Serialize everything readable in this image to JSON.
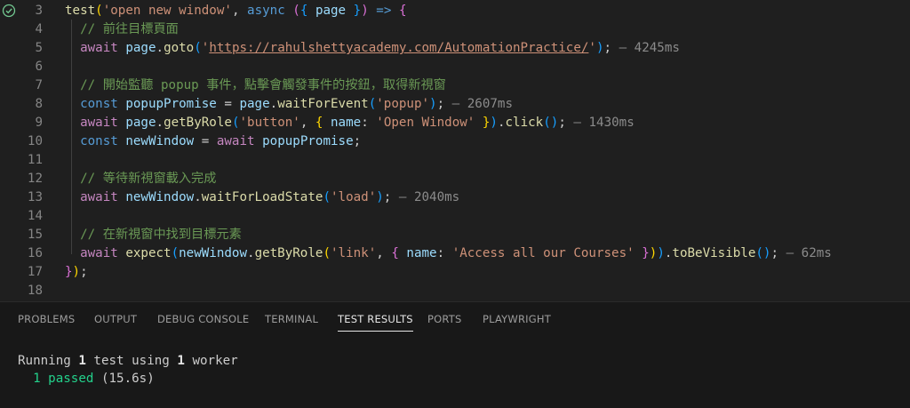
{
  "editor": {
    "lines": [
      {
        "n": "3",
        "tokens": [
          {
            "t": "test",
            "c": "fn"
          },
          {
            "t": "(",
            "c": "br1"
          },
          {
            "t": "'open new window'",
            "c": "str"
          },
          {
            "t": ", ",
            "c": "pun"
          },
          {
            "t": "async",
            "c": "kw"
          },
          {
            "t": " ",
            "c": "pun"
          },
          {
            "t": "(",
            "c": "br2"
          },
          {
            "t": "{ ",
            "c": "br3"
          },
          {
            "t": "page",
            "c": "var"
          },
          {
            "t": " }",
            "c": "br3"
          },
          {
            "t": ")",
            "c": "br2"
          },
          {
            "t": " ",
            "c": "pun"
          },
          {
            "t": "=>",
            "c": "kw"
          },
          {
            "t": " ",
            "c": "pun"
          },
          {
            "t": "{",
            "c": "br2"
          }
        ]
      },
      {
        "n": "4",
        "tokens": [
          {
            "t": "  // 前往目標頁面",
            "c": "cmt"
          }
        ]
      },
      {
        "n": "5",
        "tokens": [
          {
            "t": "  await",
            "c": "ctl"
          },
          {
            "t": " ",
            "c": "pun"
          },
          {
            "t": "page",
            "c": "var"
          },
          {
            "t": ".",
            "c": "pun"
          },
          {
            "t": "goto",
            "c": "fn"
          },
          {
            "t": "(",
            "c": "br3"
          },
          {
            "t": "'",
            "c": "str"
          },
          {
            "t": "https://rahulshettyacademy.com/AutomationPractice/",
            "c": "url"
          },
          {
            "t": "'",
            "c": "str"
          },
          {
            "t": ")",
            "c": "br3"
          },
          {
            "t": ";",
            "c": "pun"
          },
          {
            "t": " — 4245ms",
            "c": "timing"
          }
        ]
      },
      {
        "n": "6",
        "tokens": []
      },
      {
        "n": "7",
        "tokens": [
          {
            "t": "  // 開始監聽 popup 事件，點擊會觸發事件的按鈕，取得新視窗",
            "c": "cmt"
          }
        ]
      },
      {
        "n": "8",
        "tokens": [
          {
            "t": "  const",
            "c": "kw"
          },
          {
            "t": " ",
            "c": "pun"
          },
          {
            "t": "popupPromise",
            "c": "var"
          },
          {
            "t": " = ",
            "c": "pun"
          },
          {
            "t": "page",
            "c": "var"
          },
          {
            "t": ".",
            "c": "pun"
          },
          {
            "t": "waitForEvent",
            "c": "fn"
          },
          {
            "t": "(",
            "c": "br3"
          },
          {
            "t": "'popup'",
            "c": "str"
          },
          {
            "t": ")",
            "c": "br3"
          },
          {
            "t": ";",
            "c": "pun"
          },
          {
            "t": " — 2607ms",
            "c": "timing"
          }
        ]
      },
      {
        "n": "9",
        "tokens": [
          {
            "t": "  await",
            "c": "ctl"
          },
          {
            "t": " ",
            "c": "pun"
          },
          {
            "t": "page",
            "c": "var"
          },
          {
            "t": ".",
            "c": "pun"
          },
          {
            "t": "getByRole",
            "c": "fn"
          },
          {
            "t": "(",
            "c": "br3"
          },
          {
            "t": "'button'",
            "c": "str"
          },
          {
            "t": ", ",
            "c": "pun"
          },
          {
            "t": "{ ",
            "c": "br1"
          },
          {
            "t": "name",
            "c": "var"
          },
          {
            "t": ": ",
            "c": "pun"
          },
          {
            "t": "'Open Window'",
            "c": "str"
          },
          {
            "t": " }",
            "c": "br1"
          },
          {
            "t": ")",
            "c": "br3"
          },
          {
            "t": ".",
            "c": "pun"
          },
          {
            "t": "click",
            "c": "fn"
          },
          {
            "t": "()",
            "c": "br3"
          },
          {
            "t": ";",
            "c": "pun"
          },
          {
            "t": " — 1430ms",
            "c": "timing"
          }
        ]
      },
      {
        "n": "10",
        "tokens": [
          {
            "t": "  const",
            "c": "kw"
          },
          {
            "t": " ",
            "c": "pun"
          },
          {
            "t": "newWindow",
            "c": "var"
          },
          {
            "t": " = ",
            "c": "pun"
          },
          {
            "t": "await",
            "c": "ctl"
          },
          {
            "t": " ",
            "c": "pun"
          },
          {
            "t": "popupPromise",
            "c": "var"
          },
          {
            "t": ";",
            "c": "pun"
          }
        ]
      },
      {
        "n": "11",
        "tokens": []
      },
      {
        "n": "12",
        "tokens": [
          {
            "t": "  // 等待新視窗載入完成",
            "c": "cmt"
          }
        ]
      },
      {
        "n": "13",
        "tokens": [
          {
            "t": "  await",
            "c": "ctl"
          },
          {
            "t": " ",
            "c": "pun"
          },
          {
            "t": "newWindow",
            "c": "var"
          },
          {
            "t": ".",
            "c": "pun"
          },
          {
            "t": "waitForLoadState",
            "c": "fn"
          },
          {
            "t": "(",
            "c": "br3"
          },
          {
            "t": "'load'",
            "c": "str"
          },
          {
            "t": ")",
            "c": "br3"
          },
          {
            "t": ";",
            "c": "pun"
          },
          {
            "t": " — 2040ms",
            "c": "timing"
          }
        ]
      },
      {
        "n": "14",
        "tokens": []
      },
      {
        "n": "15",
        "tokens": [
          {
            "t": "  // 在新視窗中找到目標元素",
            "c": "cmt"
          }
        ]
      },
      {
        "n": "16",
        "tokens": [
          {
            "t": "  await",
            "c": "ctl"
          },
          {
            "t": " ",
            "c": "pun"
          },
          {
            "t": "expect",
            "c": "fn"
          },
          {
            "t": "(",
            "c": "br3"
          },
          {
            "t": "newWindow",
            "c": "var"
          },
          {
            "t": ".",
            "c": "pun"
          },
          {
            "t": "getByRole",
            "c": "fn"
          },
          {
            "t": "(",
            "c": "br1"
          },
          {
            "t": "'link'",
            "c": "str"
          },
          {
            "t": ", ",
            "c": "pun"
          },
          {
            "t": "{ ",
            "c": "br2"
          },
          {
            "t": "name",
            "c": "var"
          },
          {
            "t": ": ",
            "c": "pun"
          },
          {
            "t": "'Access all our Courses'",
            "c": "str"
          },
          {
            "t": " }",
            "c": "br2"
          },
          {
            "t": ")",
            "c": "br1"
          },
          {
            "t": ")",
            "c": "br3"
          },
          {
            "t": ".",
            "c": "pun"
          },
          {
            "t": "toBeVisible",
            "c": "fn"
          },
          {
            "t": "()",
            "c": "br3"
          },
          {
            "t": ";",
            "c": "pun"
          },
          {
            "t": " — 62ms",
            "c": "timing"
          }
        ]
      },
      {
        "n": "17",
        "tokens": [
          {
            "t": "}",
            "c": "br2"
          },
          {
            "t": ")",
            "c": "br1"
          },
          {
            "t": ";",
            "c": "pun"
          }
        ]
      },
      {
        "n": "18",
        "tokens": []
      }
    ],
    "pass_icon": "check-circle-icon",
    "pass_color": "#73c991"
  },
  "panel": {
    "tabs": [
      {
        "label": "PROBLEMS",
        "active": false
      },
      {
        "label": "OUTPUT",
        "active": false
      },
      {
        "label": "DEBUG CONSOLE",
        "active": false
      },
      {
        "label": "TERMINAL",
        "active": false
      },
      {
        "label": "TEST RESULTS",
        "active": true
      },
      {
        "label": "PORTS",
        "active": false
      },
      {
        "label": "PLAYWRIGHT",
        "active": false
      }
    ],
    "output": {
      "running_prefix": "Running ",
      "running_count": "1",
      "running_mid": " test using ",
      "worker_count": "1",
      "running_suffix": " worker",
      "passed": "  1 passed",
      "duration": " (15.6s)"
    }
  }
}
